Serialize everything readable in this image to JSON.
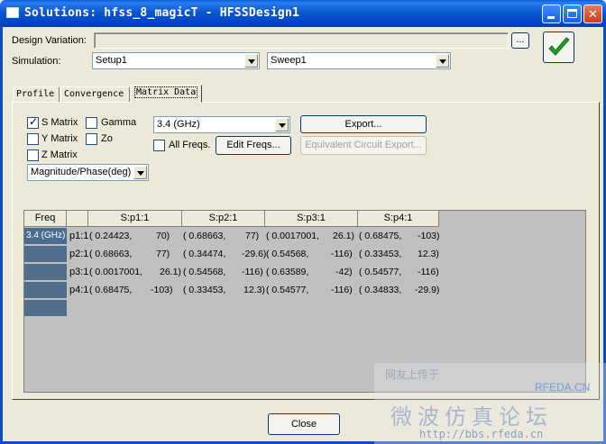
{
  "window": {
    "title": "Solutions: hfss_8_magicT - HFSSDesign1"
  },
  "form": {
    "design_variation_label": "Design Variation:",
    "design_variation_value": "",
    "browse_label": "...",
    "simulation_label": "Simulation:",
    "setup_value": "Setup1",
    "sweep_value": "Sweep1"
  },
  "tabs": [
    {
      "label": "Profile",
      "active": false
    },
    {
      "label": "Convergence",
      "active": false
    },
    {
      "label": "Matrix Data",
      "active": true
    }
  ],
  "matrix_options": {
    "s_matrix": {
      "label": "S Matrix",
      "checked": true
    },
    "y_matrix": {
      "label": "Y Matrix",
      "checked": false
    },
    "z_matrix": {
      "label": "Z Matrix",
      "checked": false
    },
    "gamma": {
      "label": "Gamma",
      "checked": false
    },
    "zo": {
      "label": "Zo",
      "checked": false
    },
    "format_value": "Magnitude/Phase(deg)",
    "freq_value": "3.4 (GHz)",
    "all_freqs": {
      "label": "All Freqs.",
      "checked": false
    },
    "edit_freqs_label": "Edit Freqs...",
    "export_label": "Export...",
    "equiv_export_label": "Equivalent Circuit Export..."
  },
  "table": {
    "freq_header": "Freq",
    "columns": [
      "S:p1:1",
      "S:p2:1",
      "S:p3:1",
      "S:p4:1"
    ],
    "freq_selected": "3.4 (GHz)",
    "rows": [
      {
        "label": "p1:1",
        "cells": [
          [
            "( 0.24423,",
            "70)"
          ],
          [
            "( 0.68663,",
            "77)"
          ],
          [
            "( 0.0017001,",
            "26.1)"
          ],
          [
            "( 0.68475,",
            "-103)"
          ]
        ]
      },
      {
        "label": "p2:1",
        "cells": [
          [
            "( 0.68663,",
            "77)"
          ],
          [
            "( 0.34474,",
            "-29.6)"
          ],
          [
            "( 0.54568,",
            "-116)"
          ],
          [
            "( 0.33453,",
            "12.3)"
          ]
        ]
      },
      {
        "label": "p3:1",
        "cells": [
          [
            "( 0.0017001,",
            "26.1)"
          ],
          [
            "( 0.54568,",
            "-116)"
          ],
          [
            "( 0.63589,",
            "-42)"
          ],
          [
            "( 0.54577,",
            "-116)"
          ]
        ]
      },
      {
        "label": "p4:1",
        "cells": [
          [
            "( 0.68475,",
            "-103)"
          ],
          [
            "( 0.33453,",
            "12.3)"
          ],
          [
            "( 0.54577,",
            "-116)"
          ],
          [
            "( 0.34833,",
            "-29.9)"
          ]
        ]
      }
    ]
  },
  "footer": {
    "close_label": "Close"
  },
  "watermark": {
    "line1": "网友上传于",
    "brand": "RFEDA.CN",
    "line2": "微波仿真论坛",
    "url": "http://bbs.rfeda.cn"
  },
  "colors": {
    "titlebar": "#0b57d0",
    "grid_bg": "#c0c0c0",
    "freq_col": "#4f6f8a",
    "ok_check": "#21a121"
  }
}
